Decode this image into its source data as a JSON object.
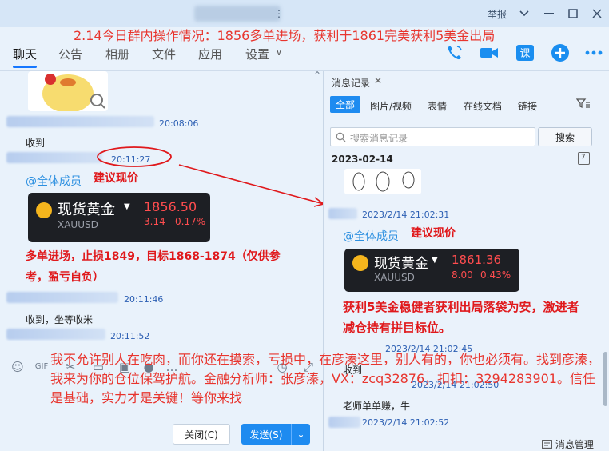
{
  "window": {
    "report_label": "举报",
    "overlay_title": "2.14今日群内操作情况：1856多单进场，获利于1861完美获利5美金出局"
  },
  "nav": {
    "tabs": [
      "聊天",
      "公告",
      "相册",
      "文件",
      "应用",
      "设置"
    ],
    "settings_caret": "∨"
  },
  "chat": {
    "msg1_time": "20:08:06",
    "msg1_text": "收到",
    "msg2_time": "20:11:27",
    "mention": "@全体成员",
    "suggest": "建议现价",
    "card1": {
      "name": "现货黄金",
      "code": "XAUUSD",
      "price": "1856.50",
      "change": "3.14",
      "pct": "0.17%"
    },
    "red_line1": "多单进场，止损1849，目标1868-1874（仅供参",
    "red_line2": "考，盈亏自负）",
    "msg3_time": "20:11:46",
    "msg3_text": "收到，坐等收米",
    "msg4_time": "20:11:52",
    "close_btn": "关闭(C)",
    "send_btn": "发送(S)",
    "send_caret": "⌄"
  },
  "panel": {
    "tab_title": "消息记录",
    "filters": [
      "全部",
      "图片/视频",
      "表情",
      "在线文档",
      "链接"
    ],
    "search_placeholder": "搜索消息记录",
    "search_btn": "搜索",
    "date": "2023-02-14",
    "calendar_day": "7",
    "rec1_time": "2023/2/14 21:02:31",
    "mention": "@全体成员",
    "suggest": "建议现价",
    "card2": {
      "name": "现货黄金",
      "code": "XAUUSD",
      "price": "1861.36",
      "change": "8.00",
      "pct": "0.43%"
    },
    "red_line1": "获利5美金稳健者获利出局落袋为安，激进者",
    "red_line2": "减仓持有拼目标位。",
    "rec2_time": "2023/2/14 21:02:45",
    "rec2_text": "收到",
    "rec3_time": "2023/2/14 21:02:50",
    "rec3_text": "老师单单赚，牛",
    "rec4_time": "2023/2/14 21:02:52",
    "mgmt": "消息管理"
  },
  "overlay_bottom": "我不允许别人在吃肉，而你还在摸索，亏损中，在彦溱这里，别人有的，你也必须有。找到彦溱，我来为你的仓位保驾护航。金融分析师：张彦溱，VX：zcq32876，扣扣：3294283901。信任是基础，实力才是关键！等你来找"
}
